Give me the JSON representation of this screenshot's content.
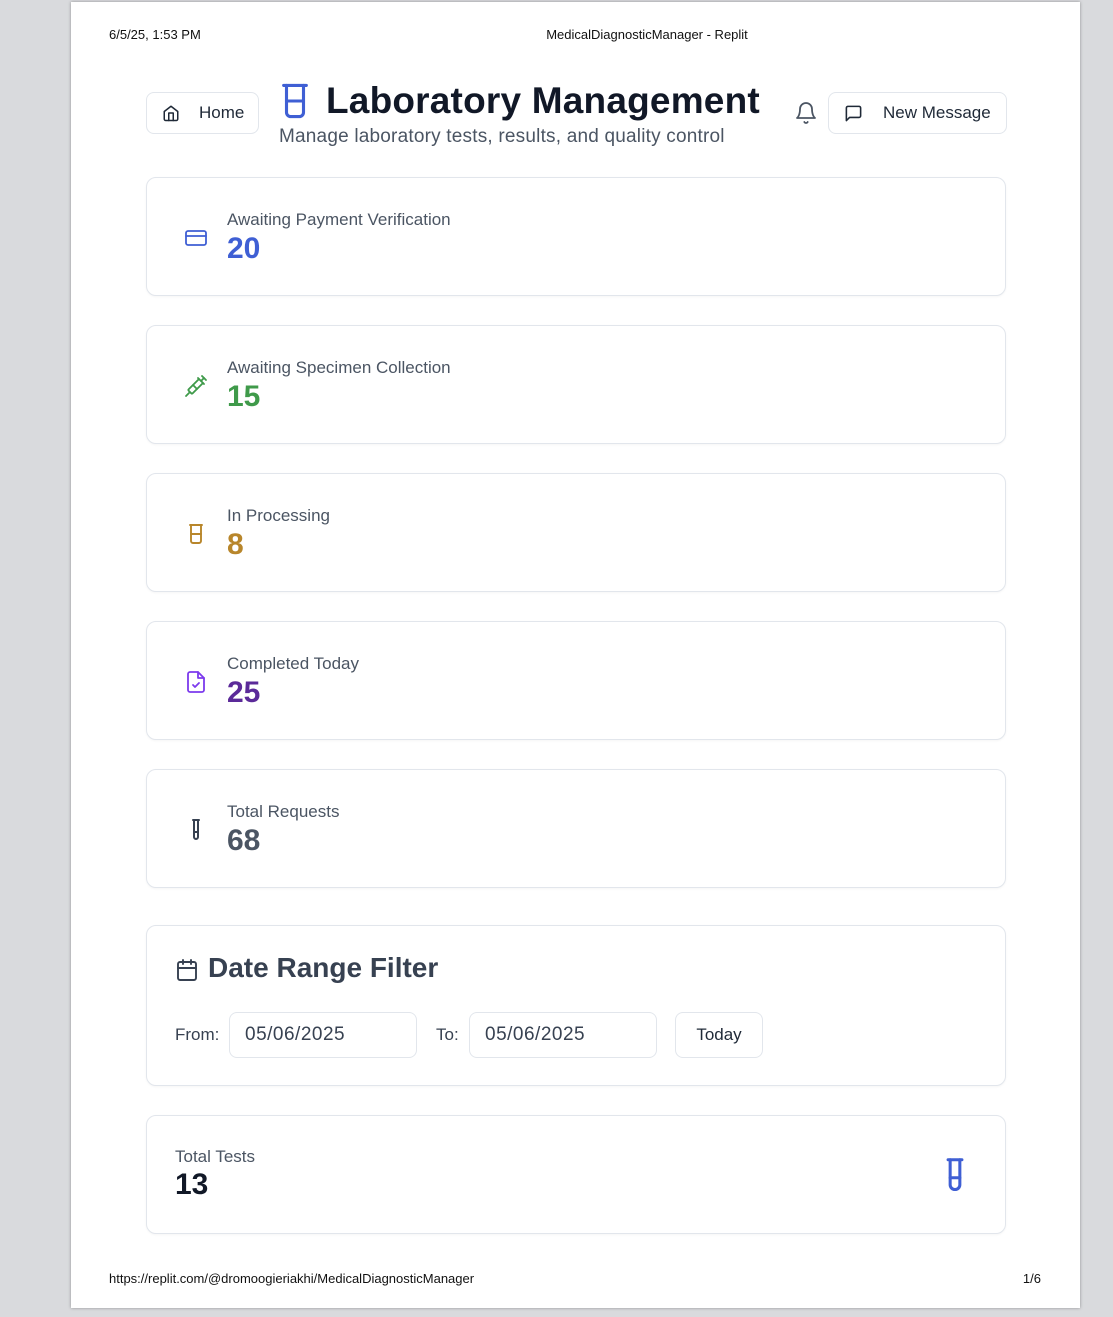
{
  "print": {
    "datetime": "6/5/25, 1:53 PM",
    "doc_title": "MedicalDiagnosticManager - Replit",
    "url": "https://replit.com/@dromoogieriakhi/MedicalDiagnosticManager",
    "page": "1/6"
  },
  "header": {
    "home_label": "Home",
    "title": "Laboratory Management",
    "subtitle": "Manage laboratory tests, results, and quality control",
    "new_message_label": "New Message"
  },
  "stats": [
    {
      "label": "Awaiting Payment Verification",
      "value": "20",
      "color": "#3f5fd4",
      "icon": "credit-card-icon"
    },
    {
      "label": "Awaiting Specimen Collection",
      "value": "15",
      "color": "#3f9a4a",
      "icon": "syringe-icon"
    },
    {
      "label": "In Processing",
      "value": "8",
      "color": "#b8862b",
      "icon": "beaker-icon"
    },
    {
      "label": "Completed Today",
      "value": "25",
      "color": "#5b2a99",
      "icon": "file-check-icon"
    },
    {
      "label": "Total Requests",
      "value": "68",
      "color": "#4b5563",
      "icon": "test-tube-icon"
    }
  ],
  "filter": {
    "title": "Date Range Filter",
    "from_label": "From:",
    "from_value": "05/06/2025",
    "to_label": "To:",
    "to_value": "05/06/2025",
    "today_label": "Today"
  },
  "total_tests": {
    "label": "Total Tests",
    "value": "13"
  },
  "colors": {
    "accent": "#3f5fd4",
    "border": "#e2e6ec"
  }
}
